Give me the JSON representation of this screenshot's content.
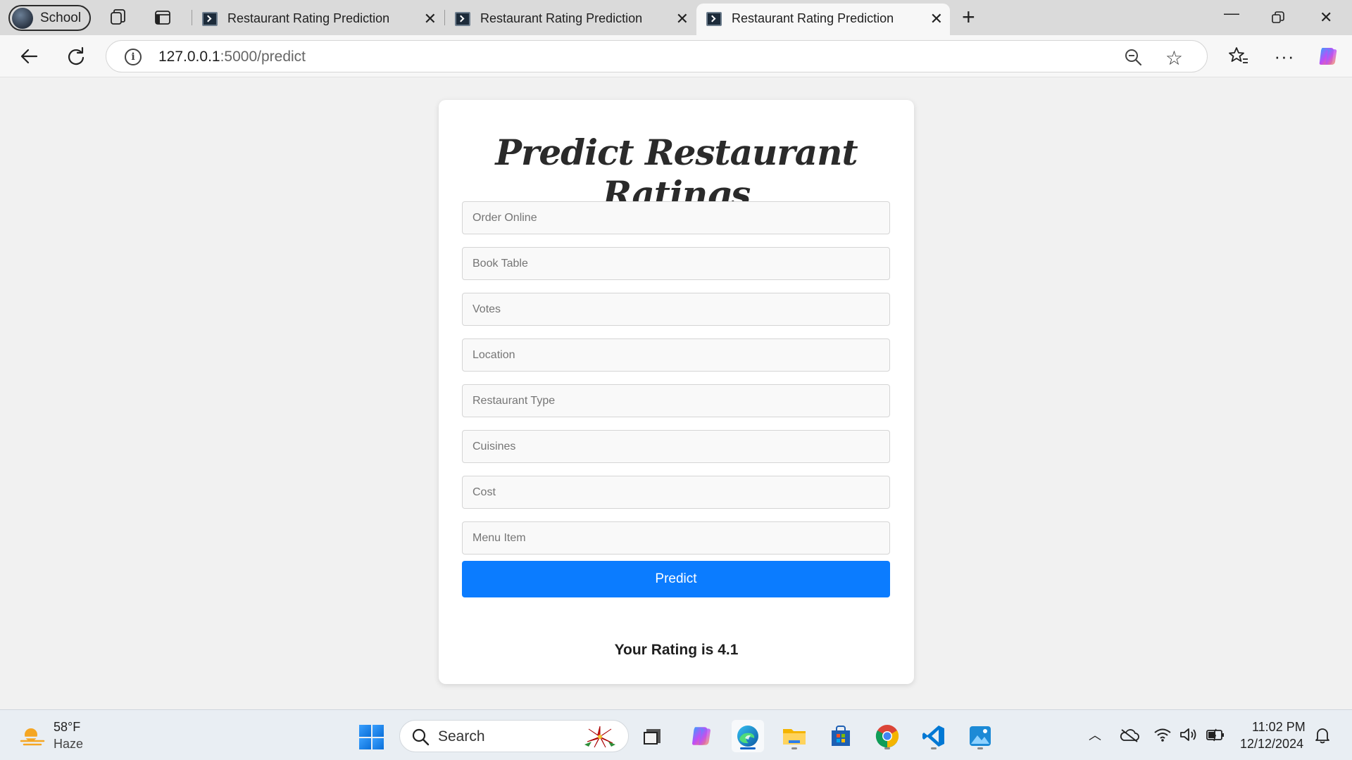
{
  "browser": {
    "profile_name": "School",
    "tabs": [
      {
        "title": "Restaurant Rating Prediction",
        "active": false
      },
      {
        "title": "Restaurant Rating Prediction",
        "active": false
      },
      {
        "title": "Restaurant Rating Prediction",
        "active": true
      }
    ],
    "url_host": "127.0.0.1",
    "url_path": ":5000/predict"
  },
  "page": {
    "heading": "Predict Restaurant Ratings",
    "fields": {
      "order_online": {
        "placeholder": "Order Online",
        "value": ""
      },
      "book_table": {
        "placeholder": "Book Table",
        "value": ""
      },
      "votes": {
        "placeholder": "Votes",
        "value": ""
      },
      "location": {
        "placeholder": "Location",
        "value": ""
      },
      "restaurant_type": {
        "placeholder": "Restaurant Type",
        "value": ""
      },
      "cuisines": {
        "placeholder": "Cuisines",
        "value": ""
      },
      "cost": {
        "placeholder": "Cost",
        "value": ""
      },
      "menu_item": {
        "placeholder": "Menu Item",
        "value": ""
      }
    },
    "predict_label": "Predict",
    "result_text": "Your Rating is 4.1",
    "accent_color": "#0b7cff"
  },
  "taskbar": {
    "weather_temp": "58°F",
    "weather_desc": "Haze",
    "search_label": "Search",
    "apps": [
      "file-manager-icon",
      "copilot-icon",
      "edge-icon",
      "file-explorer-icon",
      "microsoft-store-icon",
      "chrome-icon",
      "vscode-icon",
      "photos-icon"
    ],
    "time": "11:02 PM",
    "date": "12/12/2024"
  }
}
